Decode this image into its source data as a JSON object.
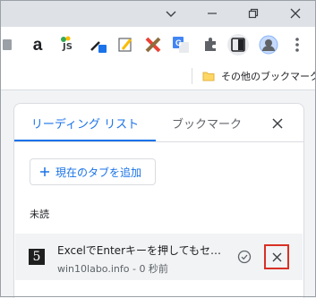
{
  "toolbar": {
    "extensions": [
      {
        "icon": "page-icon"
      },
      {
        "icon": "amazon-icon",
        "glyph": "a"
      },
      {
        "icon": "js-icon",
        "glyph": "JS"
      },
      {
        "icon": "eyedropper-icon"
      },
      {
        "icon": "pencil-icon"
      },
      {
        "icon": "cross-icon"
      },
      {
        "icon": "translate-icon"
      },
      {
        "icon": "puzzle-icon"
      },
      {
        "icon": "side-panel-icon"
      },
      {
        "icon": "avatar"
      },
      {
        "icon": "kebab-menu-icon"
      }
    ]
  },
  "bookmarks": {
    "other_label": "その他のブックマーク"
  },
  "panel": {
    "tab_reading_list": "リーディング リスト",
    "tab_bookmarks": "ブックマーク",
    "add_button_label": "現在のタブを追加",
    "section_unread": "未読",
    "items": [
      {
        "title": "ExcelでEnterキーを押してもセ…",
        "site": "win10labo.info",
        "time": "0 秒前",
        "favicon_glyph": "5"
      }
    ]
  },
  "colors": {
    "accent": "#1a73e8",
    "highlight_border": "#d93025",
    "titlebar": "#dee1e6"
  }
}
